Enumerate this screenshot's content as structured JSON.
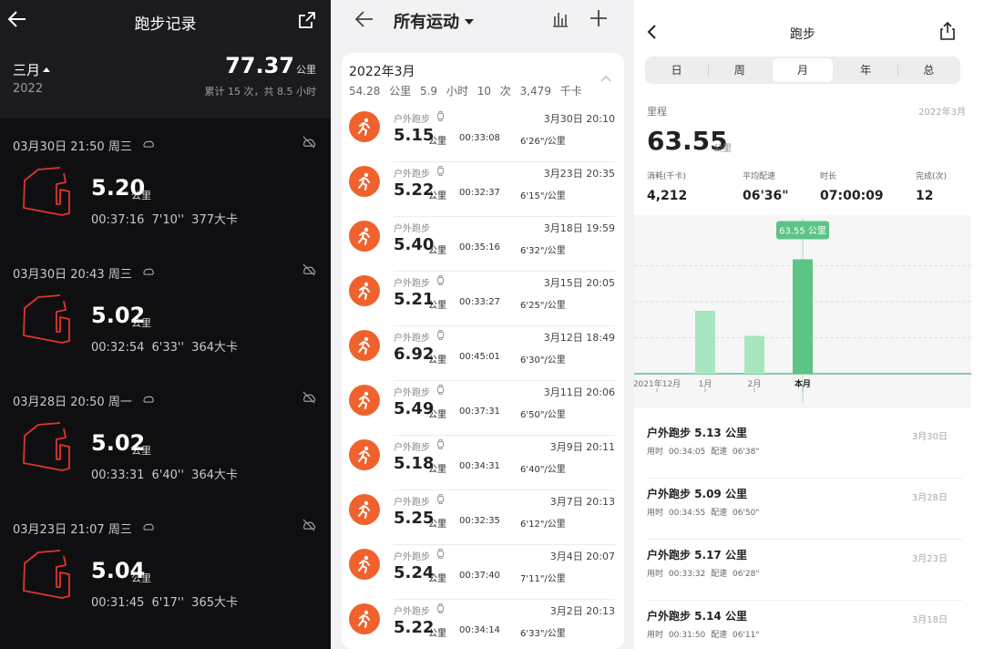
{
  "panel1": {
    "title": "跑步记录",
    "month": "三月",
    "year": "2022",
    "total_value": "77.37",
    "total_unit": "公里",
    "summary": "累计 15 次，共 8.5 小时",
    "icons": [
      "back-arrow-icon",
      "share-icon",
      "cloud-icon",
      "weather-icon",
      "route-map-icon"
    ],
    "records": [
      {
        "datetime": "03月30日  21:50  周三",
        "distance": "5.20",
        "unit": "公里",
        "stats": "00:37:16  7'10''  377大卡"
      },
      {
        "datetime": "03月30日  20:43  周三",
        "distance": "5.02",
        "unit": "公里",
        "stats": "00:32:54  6'33''  364大卡"
      },
      {
        "datetime": "03月28日  20:50  周一",
        "distance": "5.02",
        "unit": "公里",
        "stats": "00:33:31  6'40''  364大卡"
      },
      {
        "datetime": "03月23日  21:07  周三",
        "distance": "5.04",
        "unit": "公里",
        "stats": "00:31:45  6'17''  365大卡"
      }
    ],
    "route_color": "#e0352b"
  },
  "panel2": {
    "title": "所有运动",
    "month": "2022年3月",
    "month_summary": "54.28 公里   5.9 小时   10 次   3,479 千卡",
    "accent": "#f0622d",
    "icons": [
      "back-arrow-icon",
      "dropdown-icon",
      "bar-chart-icon",
      "plus-icon",
      "collapse-icon",
      "runner-icon",
      "watch-icon"
    ],
    "items": [
      {
        "label": "户外跑步",
        "watch": true,
        "time": "3月30日 20:10",
        "distance": "5.15",
        "unit": "公里",
        "duration": "00:33:08",
        "pace": "6'26\"/公里"
      },
      {
        "label": "户外跑步",
        "watch": true,
        "time": "3月23日 20:35",
        "distance": "5.22",
        "unit": "公里",
        "duration": "00:32:37",
        "pace": "6'15\"/公里"
      },
      {
        "label": "户外跑步",
        "watch": false,
        "time": "3月18日 19:59",
        "distance": "5.40",
        "unit": "公里",
        "duration": "00:35:16",
        "pace": "6'32\"/公里"
      },
      {
        "label": "户外跑步",
        "watch": true,
        "time": "3月15日 20:05",
        "distance": "5.21",
        "unit": "公里",
        "duration": "00:33:27",
        "pace": "6'25\"/公里"
      },
      {
        "label": "户外跑步",
        "watch": true,
        "time": "3月12日 18:49",
        "distance": "6.92",
        "unit": "公里",
        "duration": "00:45:01",
        "pace": "6'30\"/公里"
      },
      {
        "label": "户外跑步",
        "watch": true,
        "time": "3月11日 20:06",
        "distance": "5.49",
        "unit": "公里",
        "duration": "00:37:31",
        "pace": "6'50\"/公里"
      },
      {
        "label": "户外跑步",
        "watch": true,
        "time": "3月9日 20:11",
        "distance": "5.18",
        "unit": "公里",
        "duration": "00:34:31",
        "pace": "6'40\"/公里"
      },
      {
        "label": "户外跑步",
        "watch": true,
        "time": "3月7日 20:13",
        "distance": "5.25",
        "unit": "公里",
        "duration": "00:32:35",
        "pace": "6'12\"/公里"
      },
      {
        "label": "户外跑步",
        "watch": true,
        "time": "3月4日 20:07",
        "distance": "5.24",
        "unit": "公里",
        "duration": "00:37:40",
        "pace": "7'11\"/公里"
      },
      {
        "label": "户外跑步",
        "watch": true,
        "time": "3月2日 20:13",
        "distance": "5.22",
        "unit": "公里",
        "duration": "00:34:14",
        "pace": "6'33\"/公里"
      }
    ]
  },
  "panel3": {
    "title": "跑步",
    "tabs": [
      "日",
      "周",
      "月",
      "年",
      "总"
    ],
    "active_tab": "月",
    "metric_label": "里程",
    "period": "2022年3月",
    "big_value": "63.55",
    "big_unit": "公里",
    "icons": [
      "back-chevron-icon",
      "share-icon"
    ],
    "stats": [
      {
        "label": "消耗(千卡)",
        "value": "4,212"
      },
      {
        "label": "平均配速",
        "value": "06'36\""
      },
      {
        "label": "时长",
        "value": "07:00:09"
      },
      {
        "label": "完成(次)",
        "value": "12"
      }
    ],
    "list": [
      {
        "title": "户外跑步 5.13 公里",
        "sub": "用时 00:34:05   配速 06'38\"",
        "date": "3月30日"
      },
      {
        "title": "户外跑步 5.09 公里",
        "sub": "用时 00:34:55   配速 06'50\"",
        "date": "3月28日"
      },
      {
        "title": "户外跑步 5.17 公里",
        "sub": "用时 00:33:32   配速 06'28\"",
        "date": "3月23日"
      },
      {
        "title": "户外跑步 5.14 公里",
        "sub": "用时 00:31:50   配速 06'11\"",
        "date": "3月18日"
      }
    ],
    "colors": {
      "bar_light": "#a8e6bf",
      "bar_dark": "#5cc485",
      "tooltip": "#5cc485"
    }
  },
  "chart_data": {
    "type": "bar",
    "categories": [
      "2021年12月",
      "1月",
      "2月",
      "本月"
    ],
    "values": [
      0,
      35,
      21,
      63.55
    ],
    "highlight_index": 3,
    "tooltip": "63.55 公里",
    "ylim": [
      0,
      80
    ],
    "grid": true
  }
}
